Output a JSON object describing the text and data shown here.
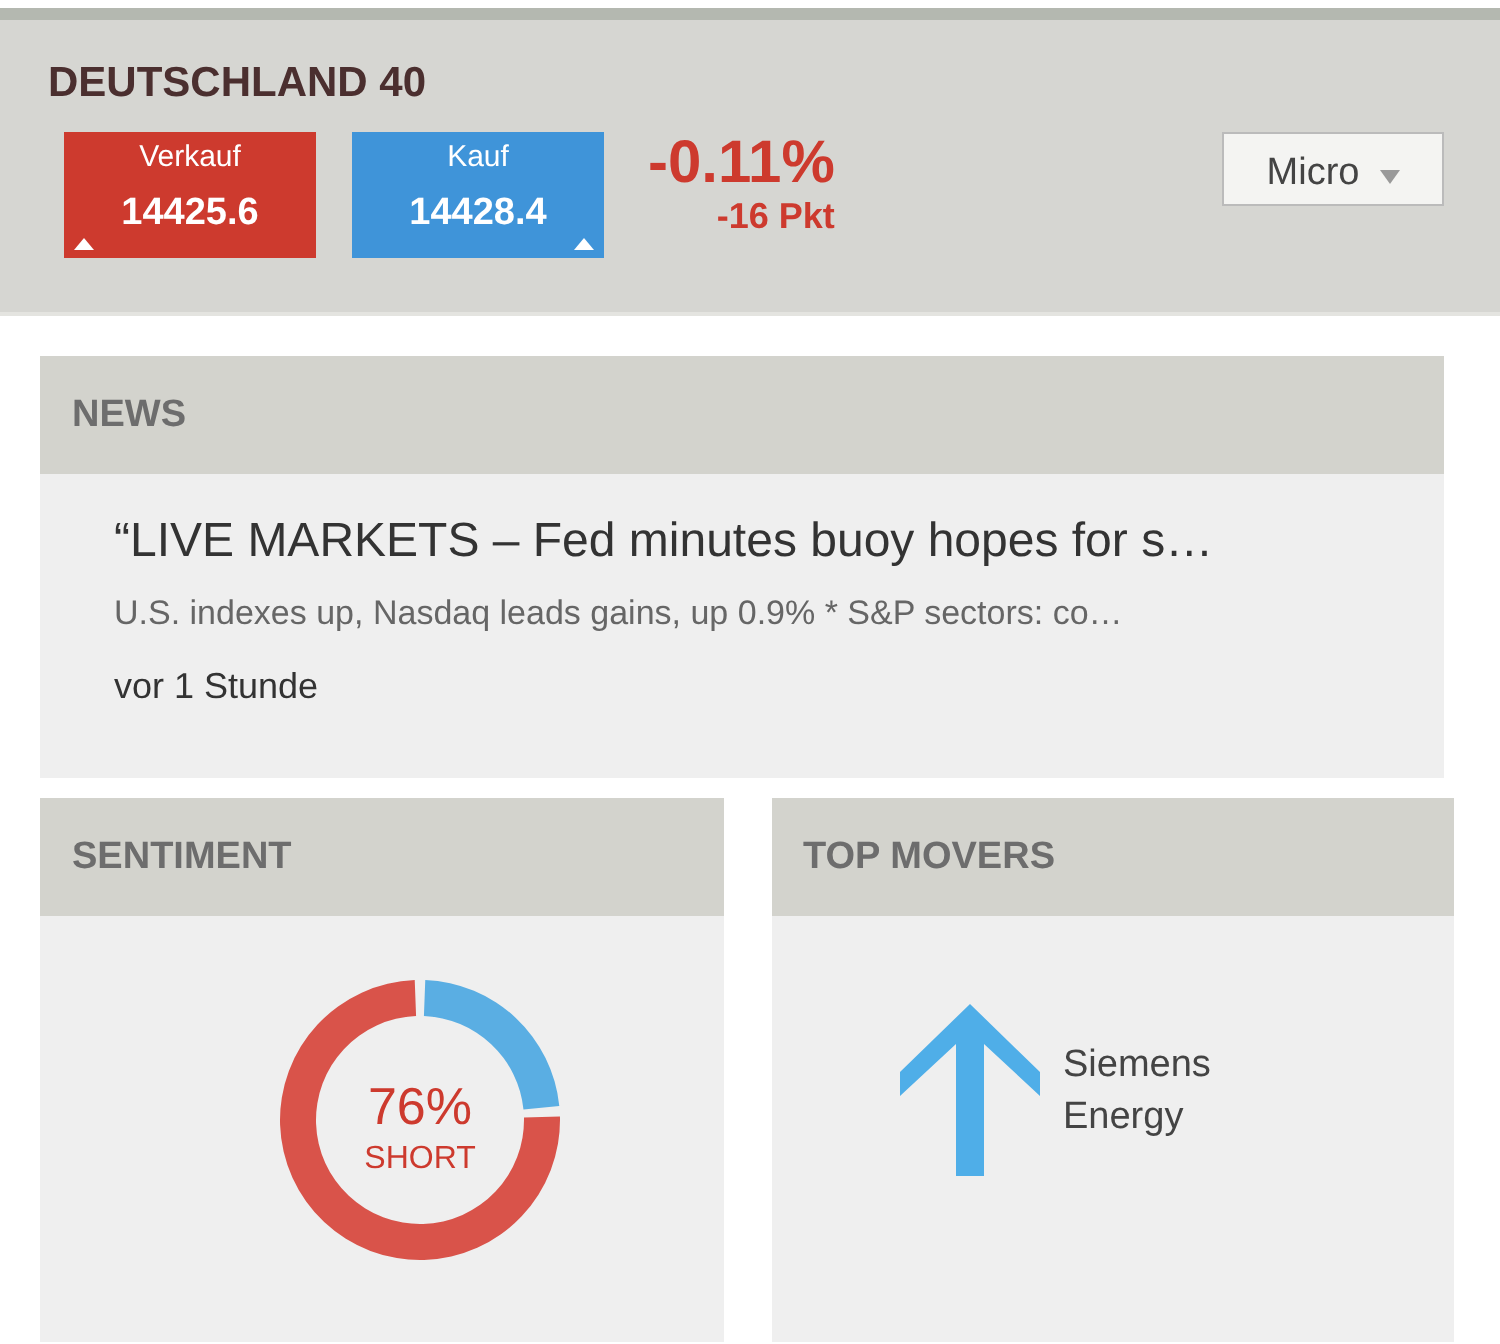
{
  "instrument": {
    "title": "DEUTSCHLAND 40",
    "prices": [
      {
        "kind": "sell",
        "label": "Verkauf",
        "value": "14425.6"
      },
      {
        "kind": "buy",
        "label": "Kauf",
        "value": "14428.4"
      }
    ],
    "change_percent": "-0.11%",
    "change_points": "-16 Pkt",
    "size_select": {
      "value": "Micro"
    }
  },
  "news": {
    "title": "NEWS",
    "headline": "“LIVE MARKETS – Fed minutes buoy hopes for s…",
    "summary": "U.S. indexes up, Nasdaq leads gains, up 0.9% * S&P sectors: co…",
    "time": "vor 1 Stunde"
  },
  "sentiment": {
    "title": "SENTIMENT",
    "chart_data": {
      "type": "donut",
      "values": [
        76,
        24
      ]
    },
    "percent": "76%",
    "label": "SHORT"
  },
  "top_movers": {
    "title": "TOP MOVERS",
    "items": [
      {
        "name": "Siemens Energy"
      }
    ]
  }
}
